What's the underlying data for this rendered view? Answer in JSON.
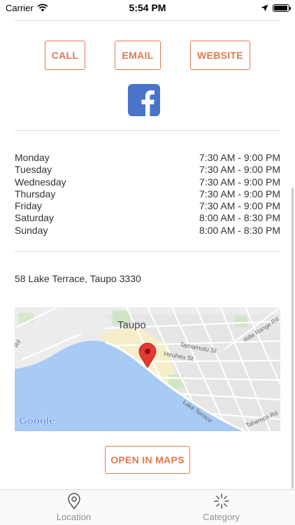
{
  "status_bar": {
    "carrier": "Carrier",
    "time": "5:54 PM",
    "battery_level": 0.95
  },
  "contact_buttons": {
    "call": "CALL",
    "email": "EMAIL",
    "website": "WEBSITE"
  },
  "hours": [
    {
      "day": "Monday",
      "time": "7:30 AM - 9:00 PM"
    },
    {
      "day": "Tuesday",
      "time": "7:30 AM - 9:00 PM"
    },
    {
      "day": "Wednesday",
      "time": "7:30 AM - 9:00 PM"
    },
    {
      "day": "Thursday",
      "time": "7:30 AM - 9:00 PM"
    },
    {
      "day": "Friday",
      "time": "7:30 AM - 9:00 PM"
    },
    {
      "day": "Saturday",
      "time": "8:00 AM - 8:30 PM"
    },
    {
      "day": "Sunday",
      "time": "8:00 AM - 8:30 PM"
    }
  ],
  "address": "58 Lake Terrace, Taupo 3330",
  "map": {
    "town": "Taupo",
    "streets": [
      "Tamamutu St",
      "Heuheu St",
      "Rifle Range Rd",
      "Lake Terrace",
      "Taharepa Rd",
      "Rd"
    ],
    "provider": "Google"
  },
  "open_maps": "OPEN IN MAPS",
  "tabs": [
    {
      "label": "Location",
      "icon": "location-pin-icon"
    },
    {
      "label": "Category",
      "icon": "category-burst-icon"
    }
  ],
  "colors": {
    "accent": "#e07a4f",
    "facebook": "#4a74c9",
    "water": "#a8cbf5",
    "pin": "#e53935"
  }
}
